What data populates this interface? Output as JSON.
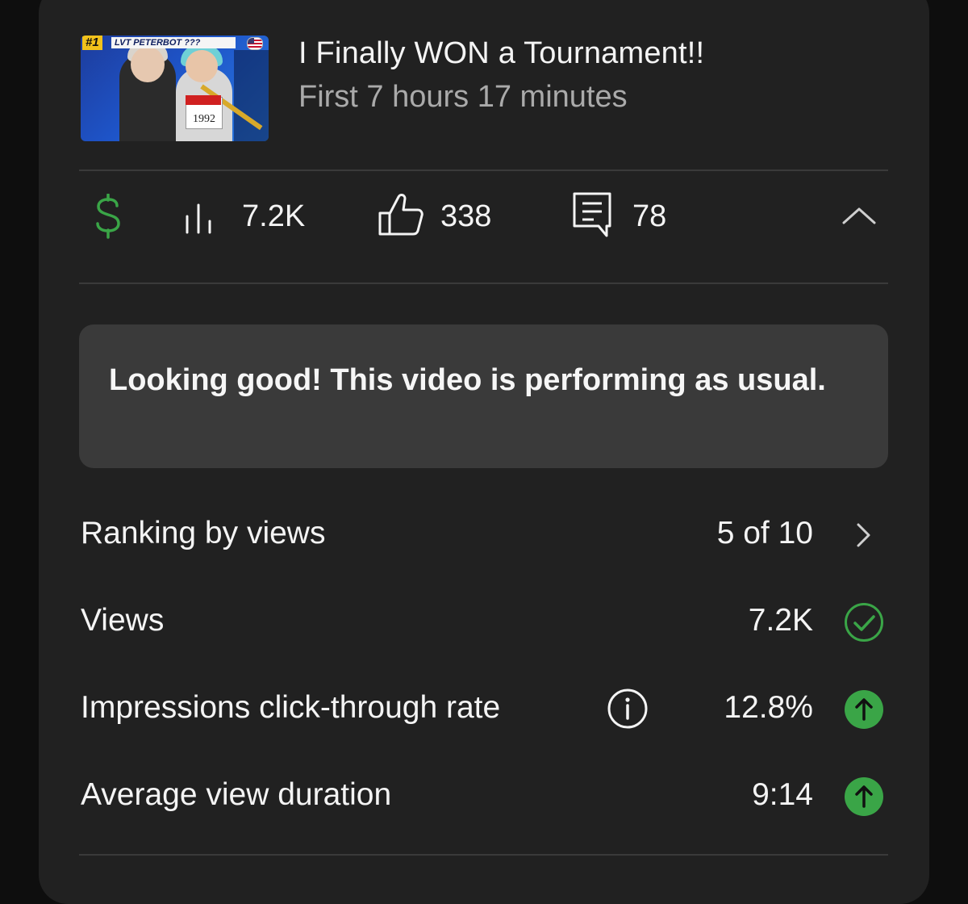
{
  "video": {
    "title": "I Finally WON a Tournament!!",
    "subtitle": "First 7 hours 17 minutes",
    "thumbnail": {
      "rank_badge": "#1",
      "banner_text": "LVT PETERBOT ???",
      "bib_number": "1992"
    }
  },
  "stats": {
    "revenue_icon": "dollar-icon",
    "views_value": "7.2K",
    "likes_value": "338",
    "comments_value": "78",
    "collapse_icon": "chevron-up-icon"
  },
  "message": {
    "text": "Looking good! This video is performing as usual."
  },
  "metrics": [
    {
      "label": "Ranking by views",
      "value": "5 of 10",
      "indicator": "chevron-right-icon"
    },
    {
      "label": "Views",
      "value": "7.2K",
      "indicator": "check-circle-icon"
    },
    {
      "label": "Impressions click-through rate",
      "value": "12.8%",
      "indicator": "arrow-up-circle-icon"
    },
    {
      "label": "Average view duration",
      "value": "9:14",
      "indicator": "arrow-up-circle-icon"
    }
  ],
  "colors": {
    "accent_green": "#3aa547",
    "card_bg": "#212121",
    "message_bg": "#3a3a3a",
    "subtitle_grey": "#aaaaaa"
  }
}
